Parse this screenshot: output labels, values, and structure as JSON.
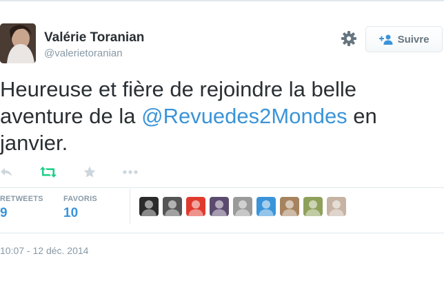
{
  "user": {
    "name": "Valérie Toranian",
    "handle": "@valerietoranian"
  },
  "follow_button": {
    "label": "Suivre"
  },
  "tweet": {
    "text_before": "Heureuse et fière de rejoindre la belle aventure de la ",
    "mention": "@Revuedes2Mondes",
    "text_after": " en janvier."
  },
  "stats": {
    "retweets_label": "RETWEETS",
    "retweets_value": "9",
    "favorites_label": "FAVORIS",
    "favorites_value": "10"
  },
  "favoriters": [
    {
      "icon": "user-avatar-icon",
      "color": "#2b2b2b"
    },
    {
      "icon": "user-avatar-icon",
      "color": "#555555"
    },
    {
      "icon": "user-avatar-icon",
      "color": "#e03a2e"
    },
    {
      "icon": "user-avatar-icon",
      "color": "#5b4b6e"
    },
    {
      "icon": "user-avatar-icon",
      "color": "#9a9a9a"
    },
    {
      "icon": "user-avatar-icon",
      "color": "#3b94d9"
    },
    {
      "icon": "user-avatar-icon",
      "color": "#a6835f"
    },
    {
      "icon": "user-avatar-icon",
      "color": "#8fa05a"
    },
    {
      "icon": "user-avatar-icon",
      "color": "#c7b3a3"
    }
  ],
  "timestamp": "10:07 - 12 déc. 2014",
  "colors": {
    "link": "#3b94d9",
    "retweet_green": "#19cf86",
    "muted": "#8899a6",
    "text": "#292f33"
  }
}
